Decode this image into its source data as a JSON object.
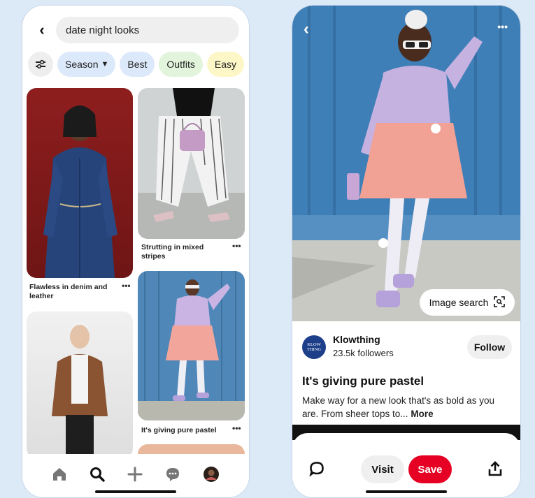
{
  "left_screen": {
    "search": {
      "query": "date night looks"
    },
    "chips": [
      "Season",
      "Best",
      "Outfits",
      "Easy"
    ],
    "pins": [
      {
        "caption": "Flawless in denim and leather",
        "more": "•••"
      },
      {
        "caption": "Strutting in mixed stripes",
        "more": "•••"
      },
      {
        "caption": "It's giving pure pastel",
        "more": "•••"
      },
      {
        "caption": "",
        "more": ""
      }
    ],
    "tabs": [
      "home-icon",
      "search-icon",
      "plus-icon",
      "chat-icon",
      "profile-avatar"
    ]
  },
  "right_screen": {
    "image_search_label": "Image search",
    "creator": {
      "logo_text": "KLOW THING",
      "name": "Klowthing",
      "followers": "23.5k followers"
    },
    "follow_label": "Follow",
    "title": "It's giving pure pastel",
    "description": "Make way for a new look that's as bold as you are. From sheer tops to...",
    "more_label": "More",
    "actions": {
      "visit_label": "Visit",
      "save_label": "Save"
    },
    "colors": {
      "save_red": "#e60023",
      "chip_blue": "#dce9fa",
      "chip_green": "#e2f4dc",
      "chip_yellow": "#fdf6c7"
    }
  }
}
